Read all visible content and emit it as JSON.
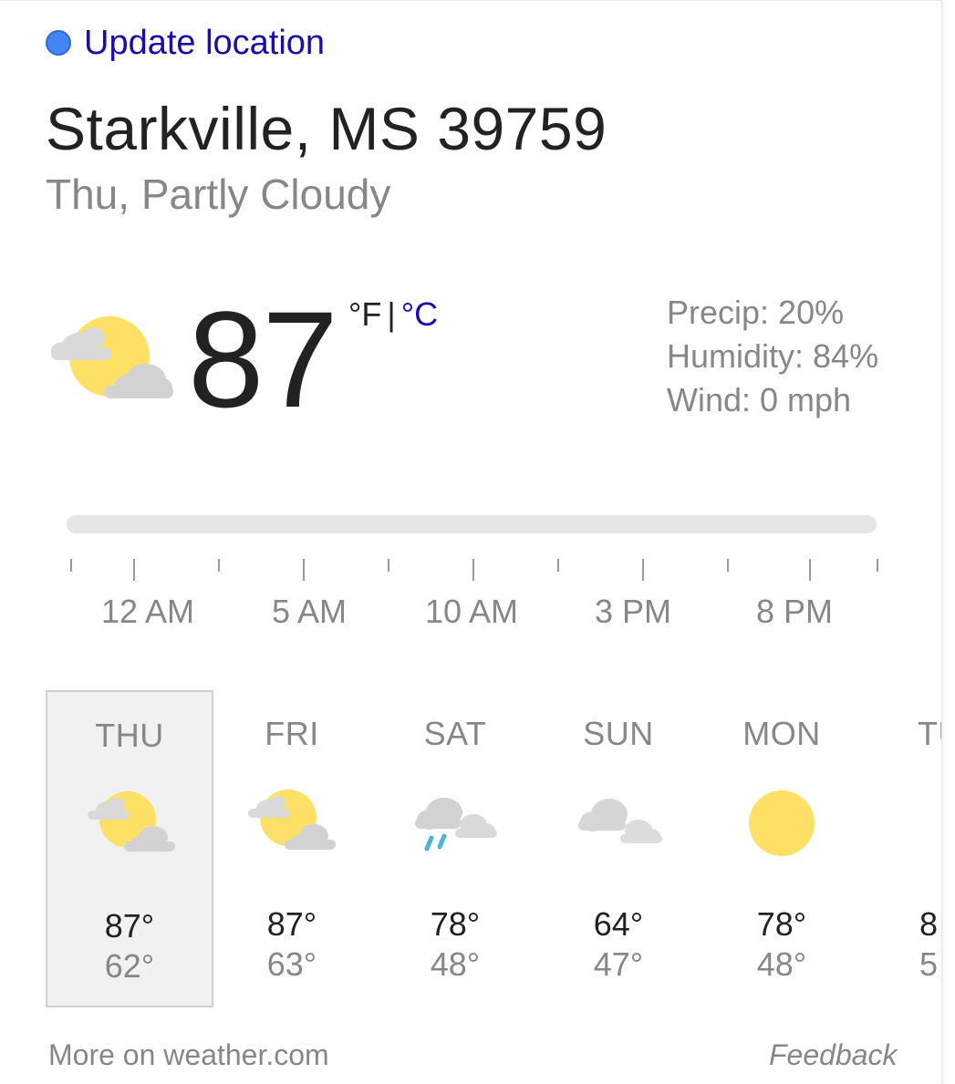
{
  "location_link": {
    "label": "Update location",
    "icon": "location-dot-icon",
    "color": "#4285f4"
  },
  "place": "Starkville, MS 39759",
  "condition": "Thu, Partly Cloudy",
  "current": {
    "temperature": "87",
    "unit_f": "°F",
    "separator": "|",
    "unit_c": "°C",
    "icon": "partly-cloudy-icon"
  },
  "details": {
    "precip": "Precip: 20%",
    "humidity": "Humidity: 84%",
    "wind": "Wind: 0 mph"
  },
  "timeline": {
    "labels": [
      "12 AM",
      "5 AM",
      "10 AM",
      "3 PM",
      "8 PM"
    ]
  },
  "forecast": [
    {
      "day": "THU",
      "high": "87°",
      "low": "62°",
      "icon": "partly-cloudy-icon",
      "selected": true
    },
    {
      "day": "FRI",
      "high": "87°",
      "low": "63°",
      "icon": "partly-cloudy-icon",
      "selected": false
    },
    {
      "day": "SAT",
      "high": "78°",
      "low": "48°",
      "icon": "rain-cloudy-icon",
      "selected": false
    },
    {
      "day": "SUN",
      "high": "64°",
      "low": "47°",
      "icon": "cloudy-icon",
      "selected": false
    },
    {
      "day": "MON",
      "high": "78°",
      "low": "48°",
      "icon": "sunny-icon",
      "selected": false
    },
    {
      "day": "TU",
      "high": "8",
      "low": "5",
      "icon": "sunny-icon",
      "selected": false
    }
  ],
  "footer": {
    "more_link": "More on weather.com",
    "feedback": "Feedback"
  },
  "colors": {
    "link": "#1a0dab",
    "sun": "#ffe066",
    "cloud": "#d8d8d8",
    "rain": "#4fb3d9",
    "muted_text": "#878787"
  }
}
